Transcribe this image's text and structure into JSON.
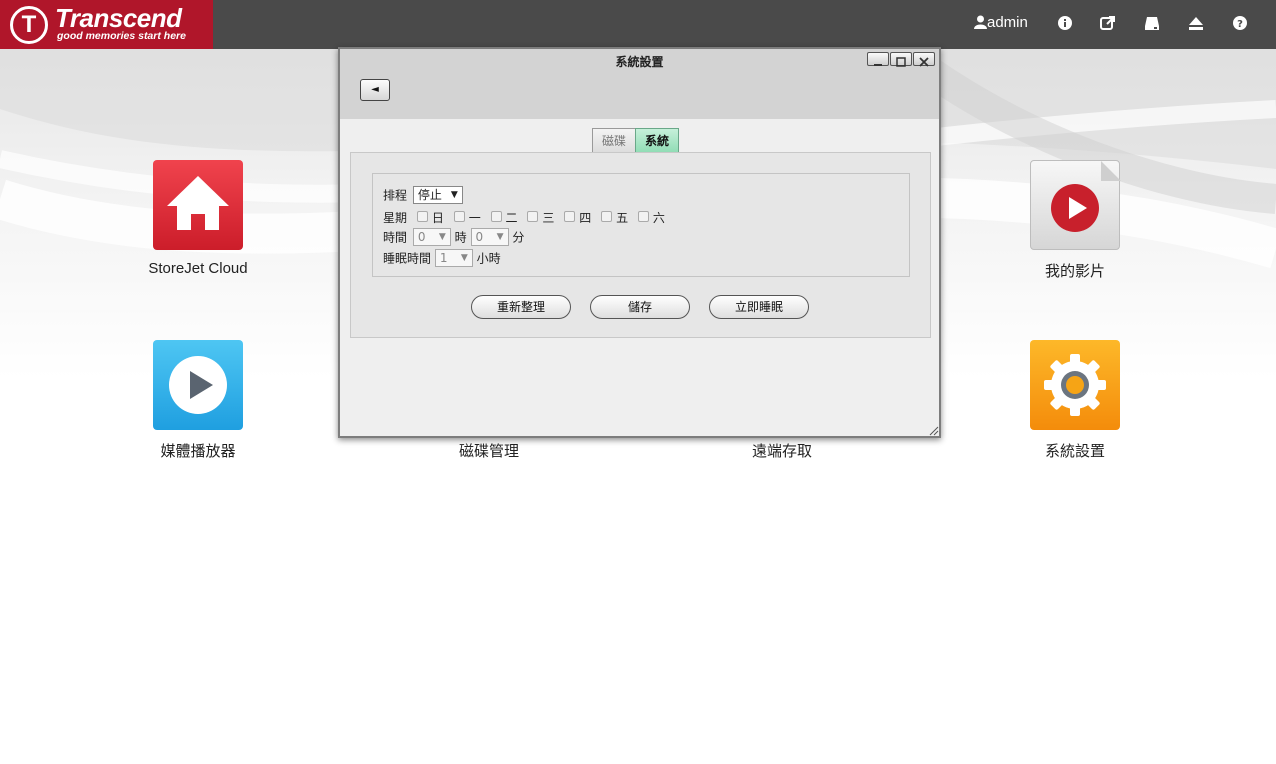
{
  "brand": {
    "logo_mark": "T",
    "name": "Transcend",
    "tagline": "good memories start here",
    "color": "#b0162a"
  },
  "topbar": {
    "user": "admin",
    "icons": [
      "user-icon",
      "info-icon",
      "external-link-icon",
      "drive-icon",
      "eject-icon",
      "help-icon"
    ]
  },
  "apps": [
    {
      "label": "StoreJet Cloud",
      "icon": "home-icon",
      "color": "#d8202f"
    },
    {
      "label": "我的影片",
      "icon": "video-icon",
      "color": "#e9e9e9"
    },
    {
      "label": "媒體播放器",
      "icon": "play-icon",
      "color": "#2ba8e6"
    },
    {
      "label": "磁碟管理",
      "icon": "disk-icon"
    },
    {
      "label": "遠端存取",
      "icon": "remote-icon"
    },
    {
      "label": "系統設置",
      "icon": "gear-icon",
      "color": "#f5a00f"
    }
  ],
  "window": {
    "title": "系統設置",
    "back_label": "◄",
    "tabs": [
      {
        "label": "磁碟",
        "active": false
      },
      {
        "label": "系統",
        "active": true
      }
    ],
    "form": {
      "schedule_label": "排程",
      "schedule_value": "停止",
      "weekday_label": "星期",
      "weekdays": [
        "日",
        "一",
        "二",
        "三",
        "四",
        "五",
        "六"
      ],
      "time_label": "時間",
      "hour_value": "0",
      "hour_unit": "時",
      "minute_value": "0",
      "minute_unit": "分",
      "sleep_label": "睡眠時間",
      "sleep_value": "1",
      "sleep_unit": "小時"
    },
    "buttons": {
      "refresh": "重新整理",
      "save": "儲存",
      "sleep_now": "立即睡眠"
    }
  }
}
